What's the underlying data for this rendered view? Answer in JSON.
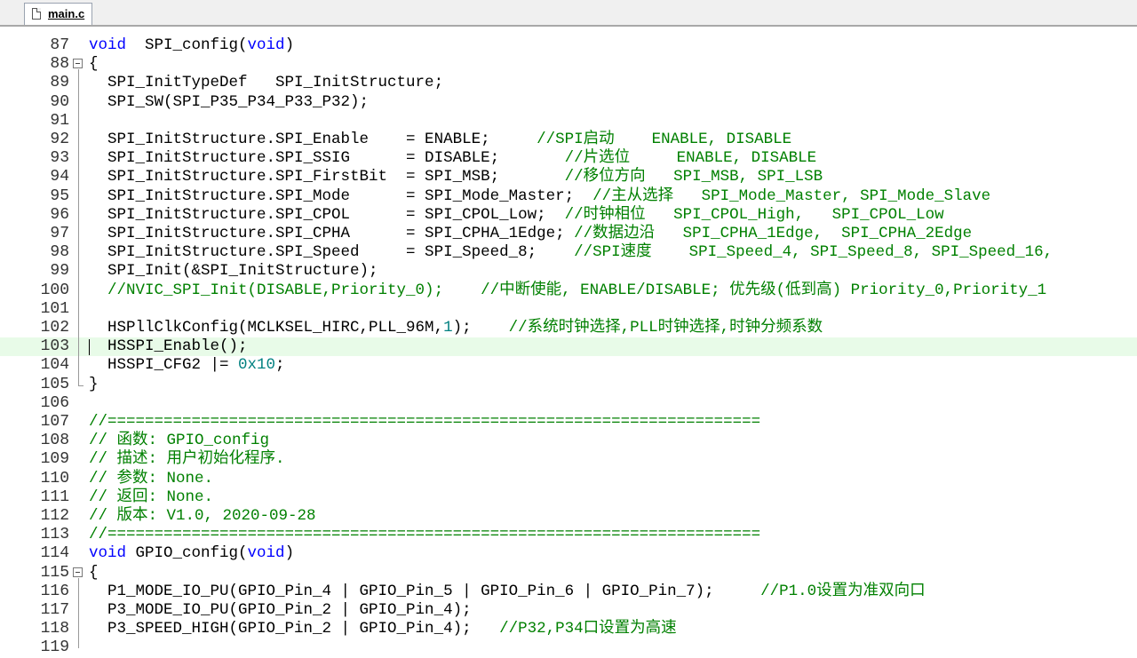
{
  "tab": {
    "filename": "main.c"
  },
  "editor": {
    "current_line": 103,
    "lines": [
      {
        "n": "87",
        "parts": [
          {
            "t": "kw",
            "v": "void"
          },
          {
            "t": "tx",
            "v": "  SPI_config("
          },
          {
            "t": "kw",
            "v": "void"
          },
          {
            "t": "tx",
            "v": ")"
          }
        ]
      },
      {
        "n": "88",
        "fold": "open",
        "parts": [
          {
            "t": "tx",
            "v": "{"
          }
        ]
      },
      {
        "n": "89",
        "parts": [
          {
            "t": "tx",
            "v": "  SPI_InitTypeDef   SPI_InitStructure;"
          }
        ]
      },
      {
        "n": "90",
        "parts": [
          {
            "t": "tx",
            "v": "  SPI_SW(SPI_P35_P34_P33_P32);"
          }
        ]
      },
      {
        "n": "91",
        "parts": []
      },
      {
        "n": "92",
        "parts": [
          {
            "t": "tx",
            "v": "  SPI_InitStructure.SPI_Enable    = ENABLE;     "
          },
          {
            "t": "cm",
            "v": "//SPI启动    ENABLE, DISABLE"
          }
        ]
      },
      {
        "n": "93",
        "parts": [
          {
            "t": "tx",
            "v": "  SPI_InitStructure.SPI_SSIG      = DISABLE;       "
          },
          {
            "t": "cm",
            "v": "//片选位     ENABLE, DISABLE"
          }
        ]
      },
      {
        "n": "94",
        "parts": [
          {
            "t": "tx",
            "v": "  SPI_InitStructure.SPI_FirstBit  = SPI_MSB;       "
          },
          {
            "t": "cm",
            "v": "//移位方向   SPI_MSB, SPI_LSB"
          }
        ]
      },
      {
        "n": "95",
        "parts": [
          {
            "t": "tx",
            "v": "  SPI_InitStructure.SPI_Mode      = SPI_Mode_Master;  "
          },
          {
            "t": "cm",
            "v": "//主从选择   SPI_Mode_Master, SPI_Mode_Slave"
          }
        ]
      },
      {
        "n": "96",
        "parts": [
          {
            "t": "tx",
            "v": "  SPI_InitStructure.SPI_CPOL      = SPI_CPOL_Low;  "
          },
          {
            "t": "cm",
            "v": "//时钟相位   SPI_CPOL_High,   SPI_CPOL_Low"
          }
        ]
      },
      {
        "n": "97",
        "parts": [
          {
            "t": "tx",
            "v": "  SPI_InitStructure.SPI_CPHA      = SPI_CPHA_1Edge; "
          },
          {
            "t": "cm",
            "v": "//数据边沿   SPI_CPHA_1Edge,  SPI_CPHA_2Edge"
          }
        ]
      },
      {
        "n": "98",
        "parts": [
          {
            "t": "tx",
            "v": "  SPI_InitStructure.SPI_Speed     = SPI_Speed_8;    "
          },
          {
            "t": "cm",
            "v": "//SPI速度    SPI_Speed_4, SPI_Speed_8, SPI_Speed_16, "
          }
        ]
      },
      {
        "n": "99",
        "parts": [
          {
            "t": "tx",
            "v": "  SPI_Init(&SPI_InitStructure);"
          }
        ]
      },
      {
        "n": "100",
        "parts": [
          {
            "t": "cm",
            "v": "  //NVIC_SPI_Init(DISABLE,Priority_0);    //中断使能, ENABLE/DISABLE; 优先级(低到高) Priority_0,Priority_1"
          }
        ]
      },
      {
        "n": "101",
        "parts": []
      },
      {
        "n": "102",
        "parts": [
          {
            "t": "tx",
            "v": "  HSPllClkConfig(MCLKSEL_HIRC,PLL_96M,"
          },
          {
            "t": "num",
            "v": "1"
          },
          {
            "t": "tx",
            "v": ");    "
          },
          {
            "t": "cm",
            "v": "//系统时钟选择,PLL时钟选择,时钟分频系数"
          }
        ]
      },
      {
        "n": "103",
        "parts": [
          {
            "t": "tx",
            "v": "  HSSPI_Enable();"
          }
        ]
      },
      {
        "n": "104",
        "parts": [
          {
            "t": "tx",
            "v": "  HSSPI_CFG2 |= "
          },
          {
            "t": "num",
            "v": "0x10"
          },
          {
            "t": "tx",
            "v": ";"
          }
        ]
      },
      {
        "n": "105",
        "parts": [
          {
            "t": "tx",
            "v": "}"
          }
        ]
      },
      {
        "n": "106",
        "parts": []
      },
      {
        "n": "107",
        "parts": [
          {
            "t": "cm",
            "v": "//======================================================================"
          }
        ]
      },
      {
        "n": "108",
        "parts": [
          {
            "t": "cm",
            "v": "// 函数: GPIO_config"
          }
        ]
      },
      {
        "n": "109",
        "parts": [
          {
            "t": "cm",
            "v": "// 描述: 用户初始化程序."
          }
        ]
      },
      {
        "n": "110",
        "parts": [
          {
            "t": "cm",
            "v": "// 参数: None."
          }
        ]
      },
      {
        "n": "111",
        "parts": [
          {
            "t": "cm",
            "v": "// 返回: None."
          }
        ]
      },
      {
        "n": "112",
        "parts": [
          {
            "t": "cm",
            "v": "// 版本: V1.0, 2020-09-28"
          }
        ]
      },
      {
        "n": "113",
        "parts": [
          {
            "t": "cm",
            "v": "//======================================================================"
          }
        ]
      },
      {
        "n": "114",
        "parts": [
          {
            "t": "kw",
            "v": "void"
          },
          {
            "t": "tx",
            "v": " GPIO_config("
          },
          {
            "t": "kw",
            "v": "void"
          },
          {
            "t": "tx",
            "v": ")"
          }
        ]
      },
      {
        "n": "115",
        "fold": "open",
        "parts": [
          {
            "t": "tx",
            "v": "{"
          }
        ]
      },
      {
        "n": "116",
        "parts": [
          {
            "t": "tx",
            "v": "  P1_MODE_IO_PU(GPIO_Pin_4 | GPIO_Pin_5 | GPIO_Pin_6 | GPIO_Pin_7);     "
          },
          {
            "t": "cm",
            "v": "//P1.0设置为准双向口"
          }
        ]
      },
      {
        "n": "117",
        "parts": [
          {
            "t": "tx",
            "v": "  P3_MODE_IO_PU(GPIO_Pin_2 | GPIO_Pin_4);"
          }
        ]
      },
      {
        "n": "118",
        "parts": [
          {
            "t": "tx",
            "v": "  P3_SPEED_HIGH(GPIO_Pin_2 | GPIO_Pin_4);   "
          },
          {
            "t": "cm",
            "v": "//P32,P34口设置为高速"
          }
        ]
      },
      {
        "n": "119",
        "parts": []
      }
    ]
  }
}
